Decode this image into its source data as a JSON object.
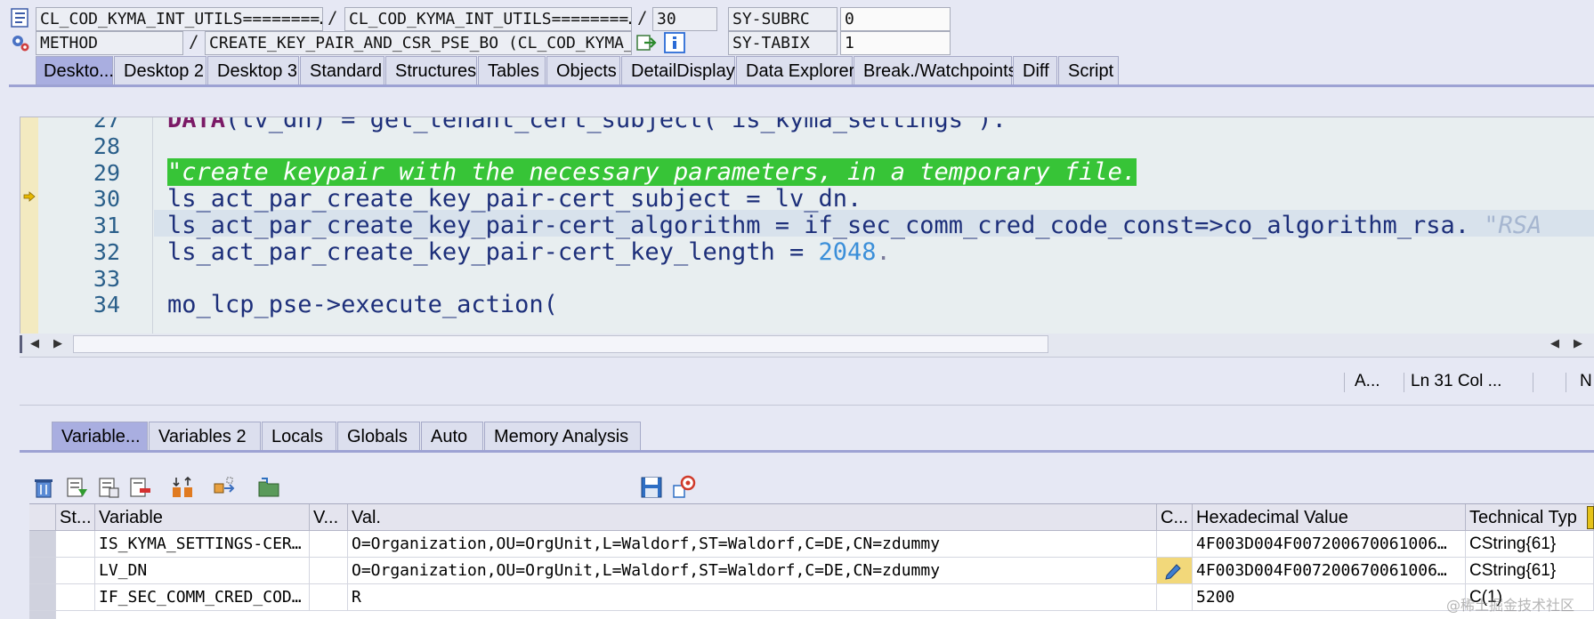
{
  "header": {
    "program": "CL_COD_KYMA_INT_UTILS========…",
    "include": "CL_COD_KYMA_INT_UTILS========…",
    "line": "30",
    "event_type": "METHOD",
    "event": "CREATE_KEY_PAIR_AND_CSR_PSE_BO (CL_COD_KYMA_IN…",
    "sysfields": [
      {
        "name": "SY-SUBRC",
        "value": "0"
      },
      {
        "name": "SY-TABIX",
        "value": "1"
      }
    ],
    "sep": "/"
  },
  "desktop_tabs": [
    "Deskto...",
    "Desktop 2",
    "Desktop 3",
    "Standard",
    "Structures",
    "Tables",
    "Objects",
    "DetailDisplay",
    "Data Explorer",
    "Break./Watchpoints",
    "Diff",
    "Script"
  ],
  "editor": {
    "lines": [
      {
        "n": "27"
      },
      {
        "n": "28"
      },
      {
        "n": "29"
      },
      {
        "n": "30"
      },
      {
        "n": "31"
      },
      {
        "n": "32"
      },
      {
        "n": "33"
      },
      {
        "n": "34"
      }
    ],
    "code": {
      "l27_kw": "DATA",
      "l27_rest": "(lv_dn) = get_tenant_cert_subject( is_kyma_settings ).",
      "l29_comment": "\"create keypair with the necessary parameters, in a temporary file.",
      "l30": "ls_act_par_create_key_pair-cert_subject = lv_dn.",
      "l31": "ls_act_par_create_key_pair-cert_algorithm = if_sec_comm_cred_code_const=>co_algorithm_rsa.",
      "l31_comment": "\"RSA",
      "l32_a": "ls_act_par_create_key_pair-cert_key_length = ",
      "l32_num": "2048",
      "l32_end": ".",
      "l34": "mo_lcp_pse->execute_action("
    }
  },
  "status": {
    "a": "A...",
    "ln": "Ln  31 Col ...",
    "n": "N"
  },
  "var_tabs": [
    "Variable...",
    "Variables 2",
    "Locals",
    "Globals",
    "Auto",
    "Memory Analysis"
  ],
  "grid": {
    "headers": [
      "St...",
      "Variable",
      "V...",
      "Val.",
      "C...",
      "Hexadecimal Value",
      "Technical Typ"
    ],
    "rows": [
      {
        "variable": "IS_KYMA_SETTINGS-CER…",
        "val": "O=Organization,OU=OrgUnit,L=Waldorf,ST=Waldorf,C=DE,CN=zdummy",
        "hex": "4F003D004F007200670061006…",
        "type": "CString{61}"
      },
      {
        "variable": "LV_DN",
        "val": "O=Organization,OU=OrgUnit,L=Waldorf,ST=Waldorf,C=DE,CN=zdummy",
        "hex": "4F003D004F007200670061006…",
        "type": "CString{61}"
      },
      {
        "variable": "IF_SEC_COMM_CRED_COD…",
        "val": "R",
        "hex": "5200",
        "type": "C(1)"
      }
    ]
  },
  "watermark": "@稀土掘金技术社区",
  "colors": {
    "comment_highlight": "#37c437",
    "keyword": "#7b1a66",
    "active_tab": "#a9aee0"
  }
}
